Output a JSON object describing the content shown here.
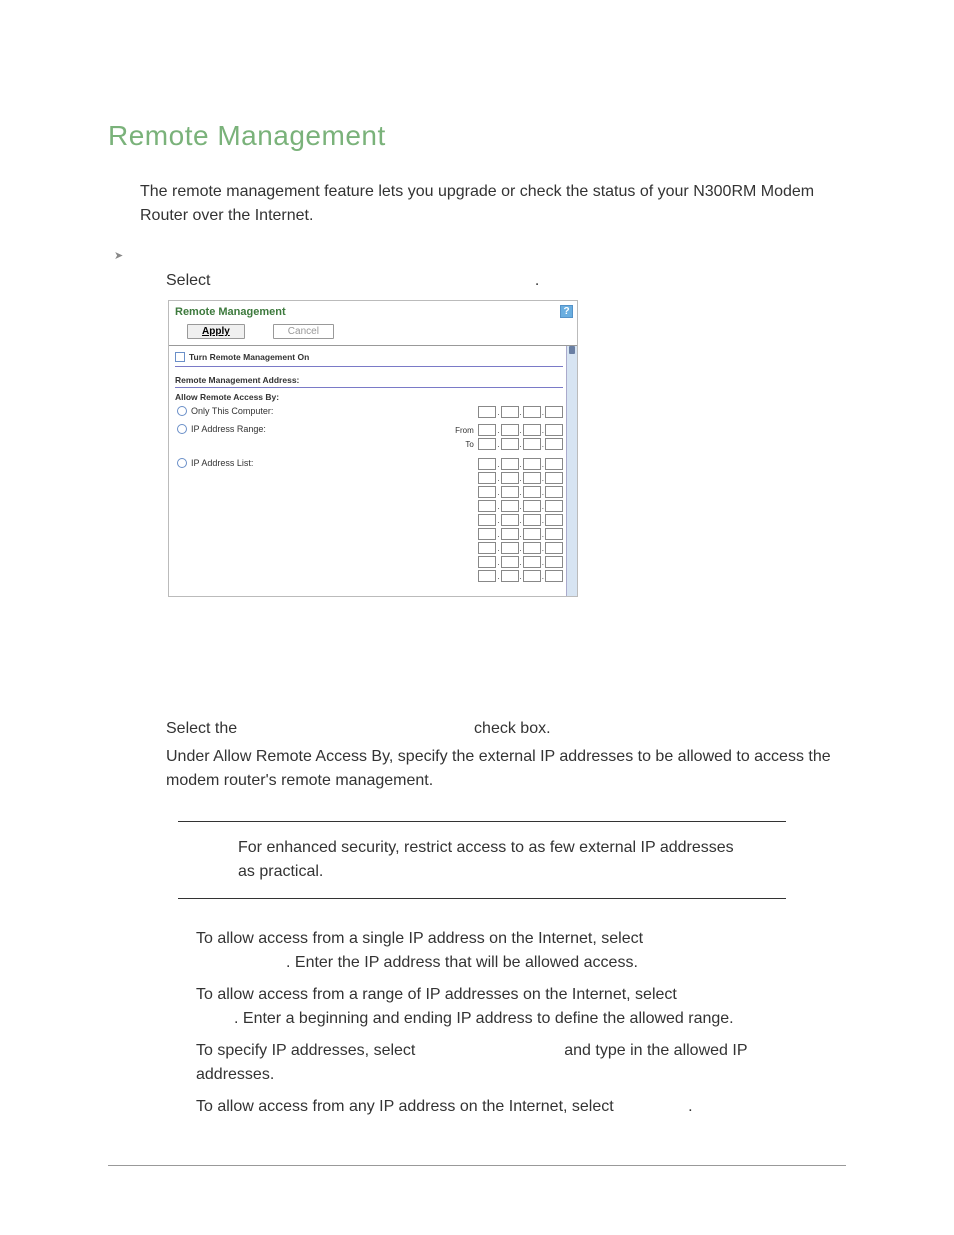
{
  "title": "Remote Management",
  "intro": "The remote management feature lets you upgrade or check the status of your N300RM Modem Router over the Internet.",
  "step1_pre": "Select ",
  "step1_post": ".",
  "router_panel": {
    "title": "Remote Management",
    "help_icon": "?",
    "apply": "Apply",
    "cancel": "Cancel",
    "turn_on_label": "Turn Remote Management On",
    "addr_hdr": "Remote Management Address:",
    "allow_hdr": "Allow Remote Access By:",
    "only_this": "Only This Computer:",
    "ip_range": "IP Address Range:",
    "from": "From",
    "to": "To",
    "ip_list": "IP Address List:"
  },
  "step2": "Select the ",
  "step2_b": " check box.",
  "step3": "Under Allow Remote Access By, specify the external IP addresses to be allowed to access the modem router's remote management.",
  "note": "For enhanced security, restrict access to as few external IP addresses as practical.",
  "b1a": "To allow access from a single IP address on the Internet, select ",
  "b1b": ". Enter the IP address that will be allowed access.",
  "b2a": "To allow access from a range of IP addresses on the Internet, select ",
  "b2b": ". Enter a beginning and ending IP address to define the allowed range.",
  "b3a": "To specify IP addresses, select ",
  "b3b": " and type in the allowed IP addresses.",
  "b4a": "To allow access from any IP address on the Internet, select ",
  "b4b": "."
}
